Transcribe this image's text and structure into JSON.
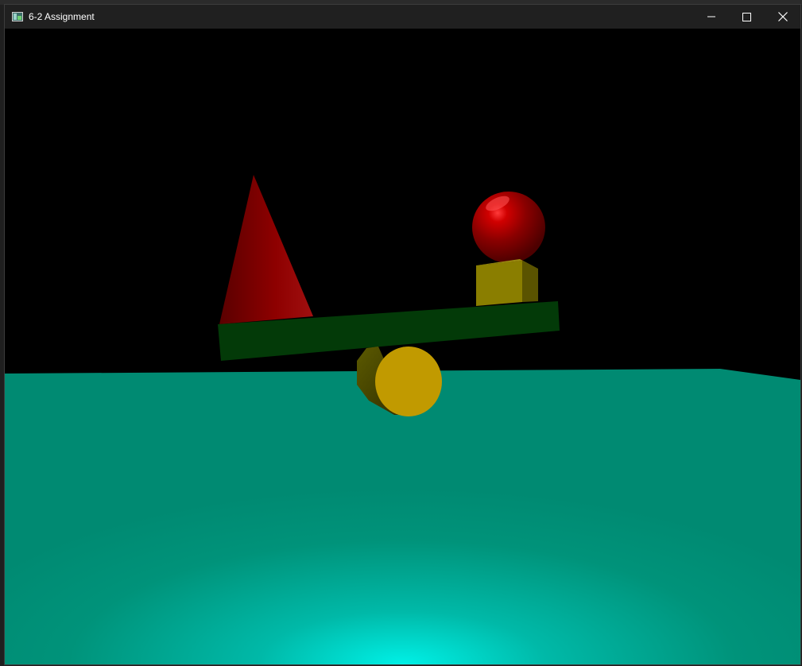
{
  "window": {
    "title": "6-2 Assignment",
    "icon": "app-window-icon",
    "buttons": {
      "minimize": "minimize-icon",
      "maximize": "maximize-icon",
      "close": "close-icon"
    }
  },
  "scene": {
    "background_color": "#000000",
    "objects": [
      "plane",
      "cone",
      "sphere",
      "cube",
      "plank",
      "cylinder"
    ],
    "colors": {
      "plane": "#00937a",
      "plane_glow": "#00e5df",
      "cone": "#8a0000",
      "sphere": "#b10000",
      "cube": "#8c7a00",
      "plank": "#033a08",
      "cylinder_face": "#c09a00",
      "cylinder_side": "#4d4a00"
    }
  }
}
